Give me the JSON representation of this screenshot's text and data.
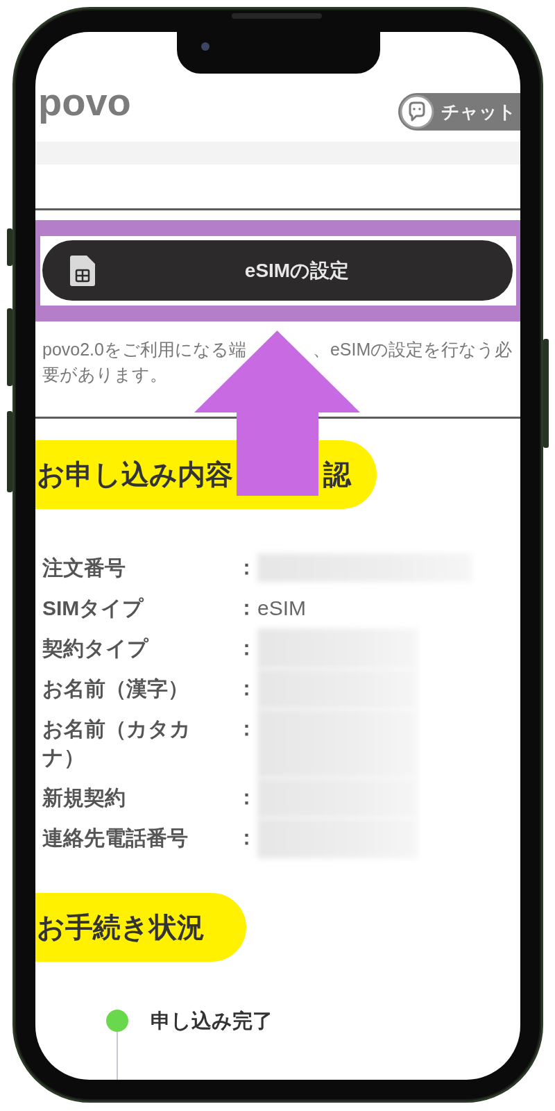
{
  "header": {
    "logo": "povo",
    "chat_button": "チャット"
  },
  "esim_button": {
    "label": "eSIMの設定",
    "highlighted": true
  },
  "description_fragments": [
    "povo2.0をご利用になる端",
    "、eSIMの設定を行なう必",
    "要があります。"
  ],
  "order_section": {
    "title_fragments": [
      "お申し込み内容",
      "認"
    ],
    "rows": [
      {
        "label": "注文番号",
        "separator": "：",
        "kind": "blurred"
      },
      {
        "label": "SIMタイプ",
        "separator": "：",
        "kind": "text",
        "value": "eSIM"
      },
      {
        "label": "契約タイプ",
        "separator": "：",
        "kind": "blurred"
      },
      {
        "label": "お名前（漢字）",
        "separator": "：",
        "kind": "blurred"
      },
      {
        "label": "お名前（カタカナ）",
        "separator": "：",
        "kind": "blurred"
      },
      {
        "label": "新規契約",
        "separator": "：",
        "kind": "blurred"
      },
      {
        "label": "連絡先電話番号",
        "separator": "：",
        "kind": "blurred"
      }
    ]
  },
  "status_section": {
    "title": "お手続き状況",
    "steps": [
      {
        "label": "申し込み完了",
        "color": "#6ad84c"
      }
    ]
  }
}
